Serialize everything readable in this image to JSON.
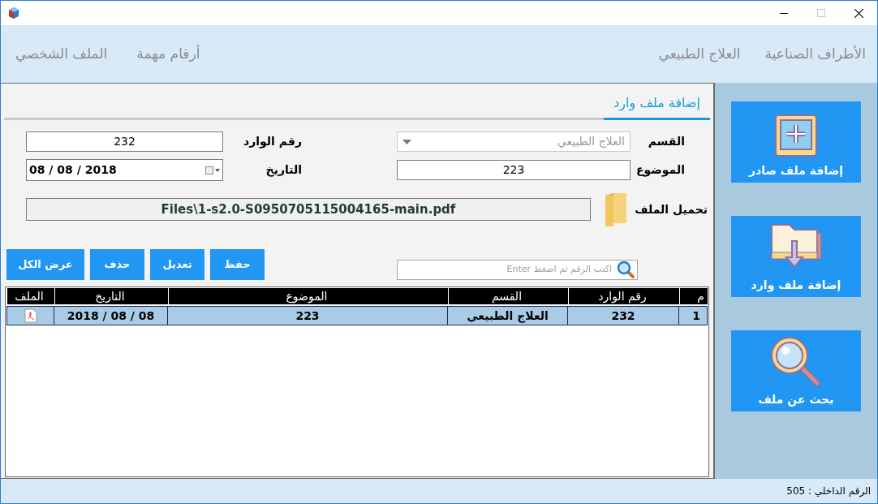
{
  "window": {
    "maximize_disabled": true
  },
  "menu_right": [
    "الأطراف الصناعية",
    "العلاج الطبيعي"
  ],
  "menu_left": [
    "أرقام مهمة",
    "الملف الشخصي"
  ],
  "sidebar": [
    {
      "kind": "add",
      "label": "إضافة ملف صادر"
    },
    {
      "kind": "folder",
      "label": "إضافة ملف وارد"
    },
    {
      "kind": "search",
      "label": "بحث عن ملف"
    }
  ],
  "tabs": [
    {
      "label": "إضافة ملف وارد",
      "selected": true
    }
  ],
  "form": {
    "department_label": "القسم",
    "department_value": "العلاج الطبيعي",
    "incoming_label": "رقم الوارد",
    "incoming_value": "232",
    "subject_label": "الموضوع",
    "subject_value": "223",
    "date_label": "التاريخ",
    "date_value": "08 / 08 / 2018",
    "file_label": "تحميل الملف",
    "file_value": "Files\\1-s2.0-S0950705115004165-main.pdf"
  },
  "search": {
    "placeholder": "اكتب الرقم ثم اضغط Enter"
  },
  "buttons": [
    "حفظ",
    "تعديل",
    "حذف",
    "عرض الكل"
  ],
  "table": {
    "columns": [
      "م",
      "رقم الوارد",
      "القسم",
      "الموضوع",
      "التاريخ",
      "الملف"
    ],
    "rows": [
      {
        "cells": [
          "1",
          "232",
          "العلاج الطبيعي",
          "223",
          "2018 / 08 / 08"
        ],
        "has_file": true,
        "selected": true
      }
    ]
  },
  "status_bar": "الرقم الداخلي : 505"
}
